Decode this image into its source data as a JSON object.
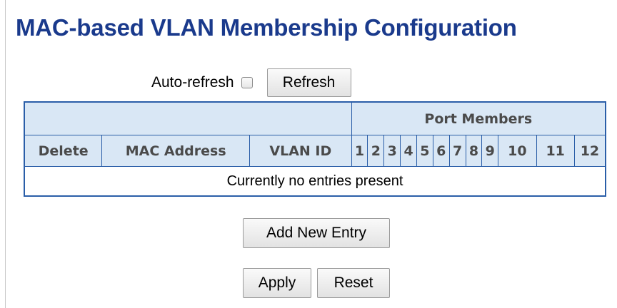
{
  "page": {
    "title": "MAC-based VLAN Membership Configuration"
  },
  "controls": {
    "auto_refresh_label": "Auto-refresh",
    "auto_refresh_checked": false,
    "refresh_button": "Refresh"
  },
  "table": {
    "group_header": "Port Members",
    "columns": {
      "delete": "Delete",
      "mac_address": "MAC Address",
      "vlan_id": "VLAN ID"
    },
    "ports": [
      "1",
      "2",
      "3",
      "4",
      "5",
      "6",
      "7",
      "8",
      "9",
      "10",
      "11",
      "12"
    ],
    "empty_message": "Currently no entries present"
  },
  "actions": {
    "add_new_entry": "Add New Entry",
    "apply": "Apply",
    "reset": "Reset"
  },
  "colors": {
    "title": "#1a3a8c",
    "table_border": "#2a5ea8",
    "header_bg": "#d9e7f5"
  }
}
